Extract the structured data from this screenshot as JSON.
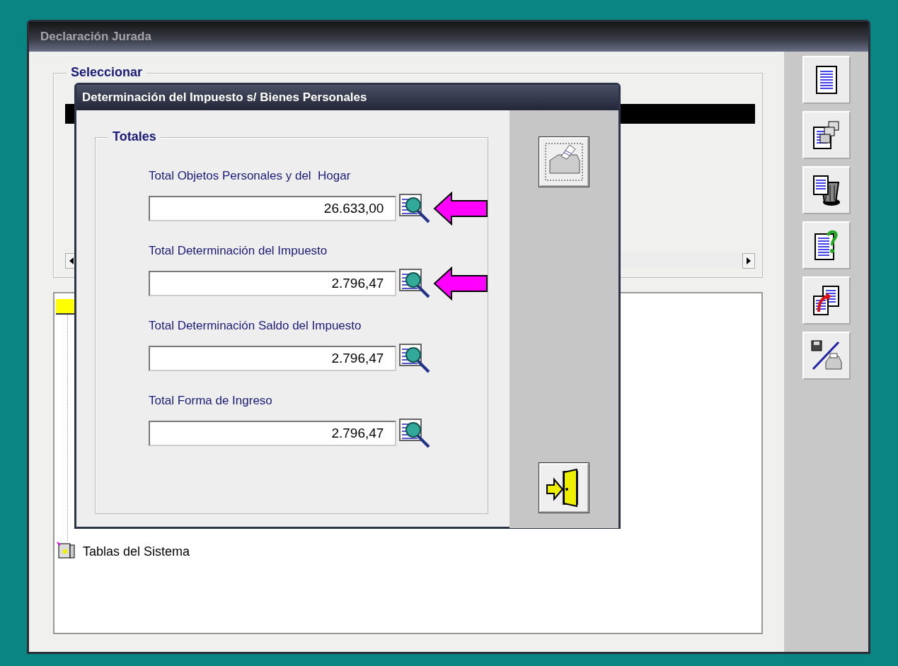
{
  "window": {
    "title": "Declaración Jurada"
  },
  "select_group": {
    "title": "Seleccionar"
  },
  "tree": {
    "items": [
      {
        "label": "Tablas del Sistema"
      }
    ]
  },
  "dialog": {
    "title": "Determinación del Impuesto s/ Bienes Personales",
    "group_title": "Totales",
    "totals": [
      {
        "label": "Total Objetos Personales y del  Hogar",
        "value": "26.633,00",
        "marked": true
      },
      {
        "label": "Total Determinación del Impuesto",
        "value": "2.796,47",
        "marked": true
      },
      {
        "label": "Total Determinación Saldo del Impuesto",
        "value": "2.796,47",
        "marked": false
      },
      {
        "label": "Total Forma de Ingreso",
        "value": "2.796,47",
        "marked": false
      }
    ]
  }
}
